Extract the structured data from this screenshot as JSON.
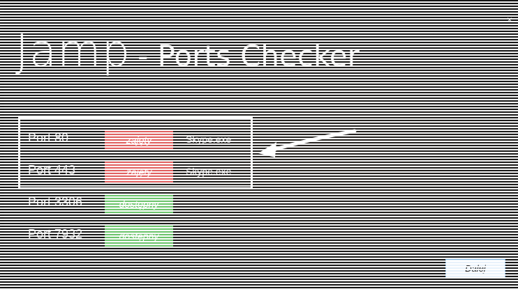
{
  "window": {
    "close_glyph": "×",
    "title_logo": "Jamp",
    "title_sub": "- Ports Checker"
  },
  "ports": [
    {
      "label": "Port 80",
      "status": "zajęty",
      "state": "busy",
      "process": "Skype.exe"
    },
    {
      "label": "Port 443",
      "status": "zajęty",
      "state": "busy",
      "process": "Skype.exe"
    },
    {
      "label": "Port 3306",
      "status": "dostępny",
      "state": "free",
      "process": ""
    },
    {
      "label": "Port 7932",
      "status": "dostępny",
      "state": "free",
      "process": ""
    }
  ],
  "footer": {
    "ok_label": "Dalej"
  },
  "colors": {
    "busy": "#e06060",
    "free": "#6cc46c",
    "highlight": "#ffffff"
  }
}
